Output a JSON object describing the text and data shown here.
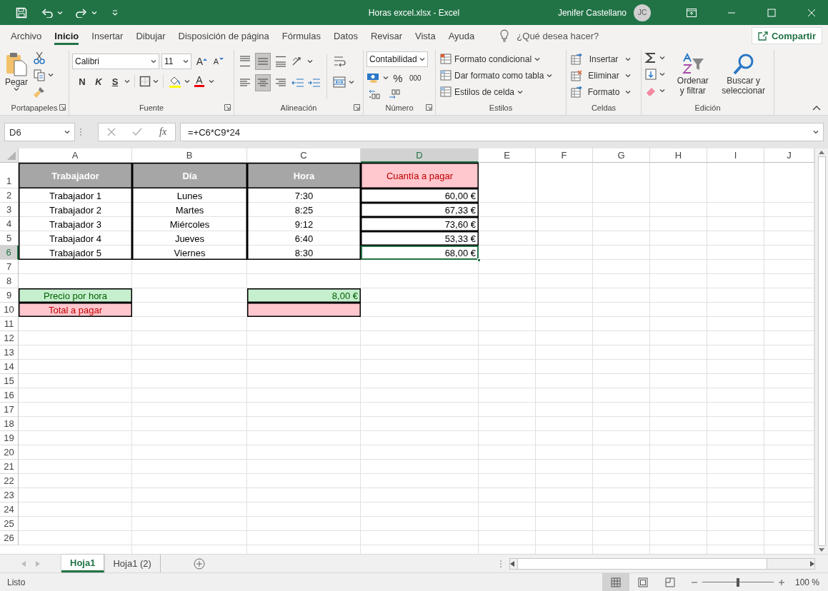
{
  "title_bar": {
    "title": "Horas excel.xlsx  -  Excel",
    "user": "Jenifer Castellano",
    "initials": "JC"
  },
  "menu_tabs": [
    {
      "label": "Archivo",
      "selected": false
    },
    {
      "label": "Inicio",
      "selected": true
    },
    {
      "label": "Insertar",
      "selected": false
    },
    {
      "label": "Dibujar",
      "selected": false
    },
    {
      "label": "Disposición de página",
      "selected": false
    },
    {
      "label": "Fórmulas",
      "selected": false
    },
    {
      "label": "Datos",
      "selected": false
    },
    {
      "label": "Revisar",
      "selected": false
    },
    {
      "label": "Vista",
      "selected": false
    },
    {
      "label": "Ayuda",
      "selected": false
    }
  ],
  "tell_me": {
    "placeholder": "¿Qué desea hacer?"
  },
  "share_button": "Compartir",
  "ribbon": {
    "groups": [
      {
        "kind": "clipboard",
        "label": "Portapapeles",
        "launcher": true,
        "paste": "Pegar"
      },
      {
        "kind": "font",
        "label": "Fuente",
        "launcher": true,
        "font": "Calibri",
        "size": "11",
        "grow": "A",
        "shrink": "A",
        "bold": "N",
        "italic": "K",
        "underline": "S",
        "font_color": "A"
      },
      {
        "kind": "alignment",
        "label": "Alineación",
        "launcher": true,
        "align_buttons": [
          {
            "kind": "top",
            "selected": false
          },
          {
            "kind": "middle",
            "selected": true
          },
          {
            "kind": "bottom",
            "selected": false
          },
          {
            "kind": "left",
            "selected": false
          },
          {
            "kind": "center",
            "selected": true
          },
          {
            "kind": "right",
            "selected": false
          }
        ]
      },
      {
        "kind": "number",
        "label": "Número",
        "launcher": true,
        "format": "Contabilidad",
        "percent": "%",
        "thousands": "000"
      },
      {
        "kind": "styles",
        "label": "Estilos",
        "launcher": false,
        "items": [
          "Formato condicional",
          "Dar formato como tabla",
          "Estilos de celda"
        ]
      },
      {
        "kind": "cells",
        "label": "Celdas",
        "launcher": false,
        "items": [
          "Insertar",
          "Eliminar",
          "Formato"
        ]
      },
      {
        "kind": "editing",
        "label": "Edición",
        "launcher": false,
        "sort": "Ordenar y filtrar",
        "find": "Buscar y seleccionar"
      }
    ]
  },
  "formula_bar": {
    "name_box": "D6",
    "function_label": "fx",
    "formula": "=+C6*C9*24"
  },
  "sheet": {
    "columns": [
      {
        "label": "A",
        "selected": false
      },
      {
        "label": "B",
        "selected": false
      },
      {
        "label": "C",
        "selected": false
      },
      {
        "label": "D",
        "selected": true
      },
      {
        "label": "E",
        "selected": false
      },
      {
        "label": "F",
        "selected": false
      },
      {
        "label": "G",
        "selected": false
      },
      {
        "label": "H",
        "selected": false
      },
      {
        "label": "I",
        "selected": false
      },
      {
        "label": "J",
        "selected": false
      }
    ],
    "rows": [
      {
        "label": "1",
        "selected": false,
        "cells": [
          {
            "kind": "head",
            "text": "Trabajador"
          },
          {
            "kind": "head",
            "text": "Día"
          },
          {
            "kind": "head",
            "text": "Hora"
          },
          {
            "kind": "head-pink",
            "text": "Cuantía a pagar"
          }
        ]
      },
      {
        "label": "2",
        "selected": false,
        "cells": [
          {
            "kind": "body",
            "text": "Trabajador 1"
          },
          {
            "kind": "body",
            "text": "Lunes"
          },
          {
            "kind": "body",
            "text": "7:30"
          },
          {
            "kind": "money",
            "text": "60,00 €"
          }
        ]
      },
      {
        "label": "3",
        "selected": false,
        "cells": [
          {
            "kind": "body",
            "text": "Trabajador 2"
          },
          {
            "kind": "body",
            "text": "Martes"
          },
          {
            "kind": "body",
            "text": "8:25"
          },
          {
            "kind": "money",
            "text": "67,33 €"
          }
        ]
      },
      {
        "label": "4",
        "selected": false,
        "cells": [
          {
            "kind": "body",
            "text": "Trabajador 3"
          },
          {
            "kind": "body",
            "text": "Miércoles"
          },
          {
            "kind": "body",
            "text": "9:12"
          },
          {
            "kind": "money",
            "text": "73,60 €"
          }
        ]
      },
      {
        "label": "5",
        "selected": false,
        "cells": [
          {
            "kind": "body",
            "text": "Trabajador 4"
          },
          {
            "kind": "body",
            "text": "Jueves"
          },
          {
            "kind": "body",
            "text": "6:40"
          },
          {
            "kind": "money",
            "text": "53,33 €"
          }
        ]
      },
      {
        "label": "6",
        "selected": true,
        "cells": [
          {
            "kind": "body-end",
            "text": "Trabajador 5"
          },
          {
            "kind": "body-end",
            "text": "Viernes"
          },
          {
            "kind": "body-end",
            "text": "8:30"
          },
          {
            "kind": "money",
            "text": "68,00 €"
          }
        ]
      },
      {
        "label": "7",
        "selected": false
      },
      {
        "label": "8",
        "selected": false
      },
      {
        "label": "9",
        "selected": false,
        "cells": [
          {
            "kind": "green",
            "text": "Precio por hora"
          },
          {
            "kind": "blank"
          },
          {
            "kind": "green-money",
            "text": "8,00 €"
          }
        ]
      },
      {
        "label": "10",
        "selected": false,
        "cells": [
          {
            "kind": "pink",
            "text": "Total a pagar"
          },
          {
            "kind": "blank"
          },
          {
            "kind": "pink"
          }
        ]
      },
      {
        "label": "11",
        "selected": false
      },
      {
        "label": "12",
        "selected": false
      },
      {
        "label": "13",
        "selected": false
      },
      {
        "label": "14",
        "selected": false
      },
      {
        "label": "15",
        "selected": false
      },
      {
        "label": "16",
        "selected": false
      },
      {
        "label": "17",
        "selected": false
      },
      {
        "label": "18",
        "selected": false
      },
      {
        "label": "19",
        "selected": false
      },
      {
        "label": "20",
        "selected": false
      },
      {
        "label": "21",
        "selected": false
      },
      {
        "label": "22",
        "selected": false
      },
      {
        "label": "23",
        "selected": false
      },
      {
        "label": "24",
        "selected": false
      },
      {
        "label": "25",
        "selected": false
      },
      {
        "label": "26",
        "selected": false
      }
    ]
  },
  "sheet_tabs": [
    {
      "label": "Hoja1",
      "selected": true
    },
    {
      "label": "Hoja1 (2)",
      "selected": false
    }
  ],
  "status_bar": {
    "status": "Listo",
    "views": [
      {
        "kind": "normal",
        "selected": true
      },
      {
        "kind": "page-layout",
        "selected": false
      },
      {
        "kind": "page-break",
        "selected": false
      }
    ],
    "zoom": {
      "level": 0.5,
      "reading": "100 %"
    }
  }
}
